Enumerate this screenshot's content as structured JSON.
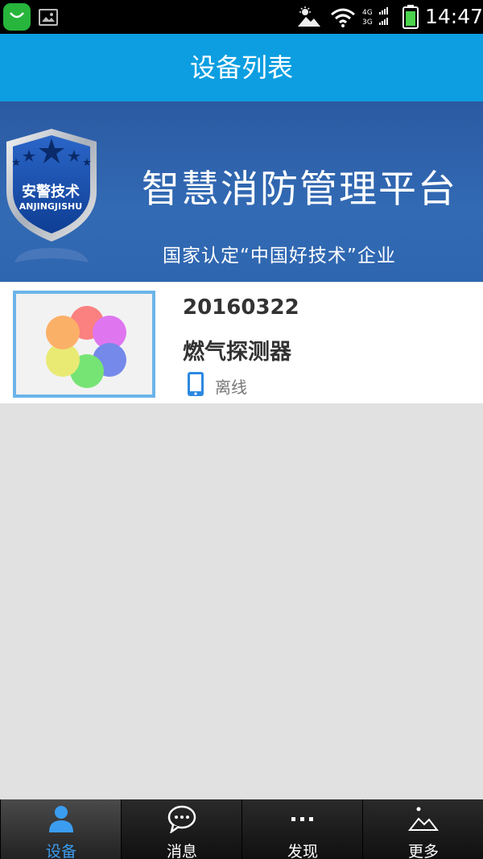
{
  "status_bar": {
    "time": "14:47",
    "signal_labels": {
      "top": "4G",
      "bottom": "3G"
    }
  },
  "header": {
    "title": "设备列表"
  },
  "banner": {
    "badge_text": "安警技术",
    "badge_sub": "ANJINGJISHU",
    "title": "智慧消防管理平台",
    "subtitle": "国家认定“中国好技术”企业"
  },
  "devices": [
    {
      "id": "20160322",
      "name": "燃气探测器",
      "status": "离线"
    }
  ],
  "nav": {
    "items": [
      {
        "label": "设备",
        "icon": "user-icon",
        "active": true
      },
      {
        "label": "消息",
        "icon": "chat-icon",
        "active": false
      },
      {
        "label": "发现",
        "icon": "dots-icon",
        "active": false
      },
      {
        "label": "更多",
        "icon": "mountain-icon",
        "active": false
      }
    ]
  },
  "colors": {
    "title_bar": "#0c9ee1",
    "banner": "#2f66b0",
    "active_nav": "#3b9df0"
  }
}
